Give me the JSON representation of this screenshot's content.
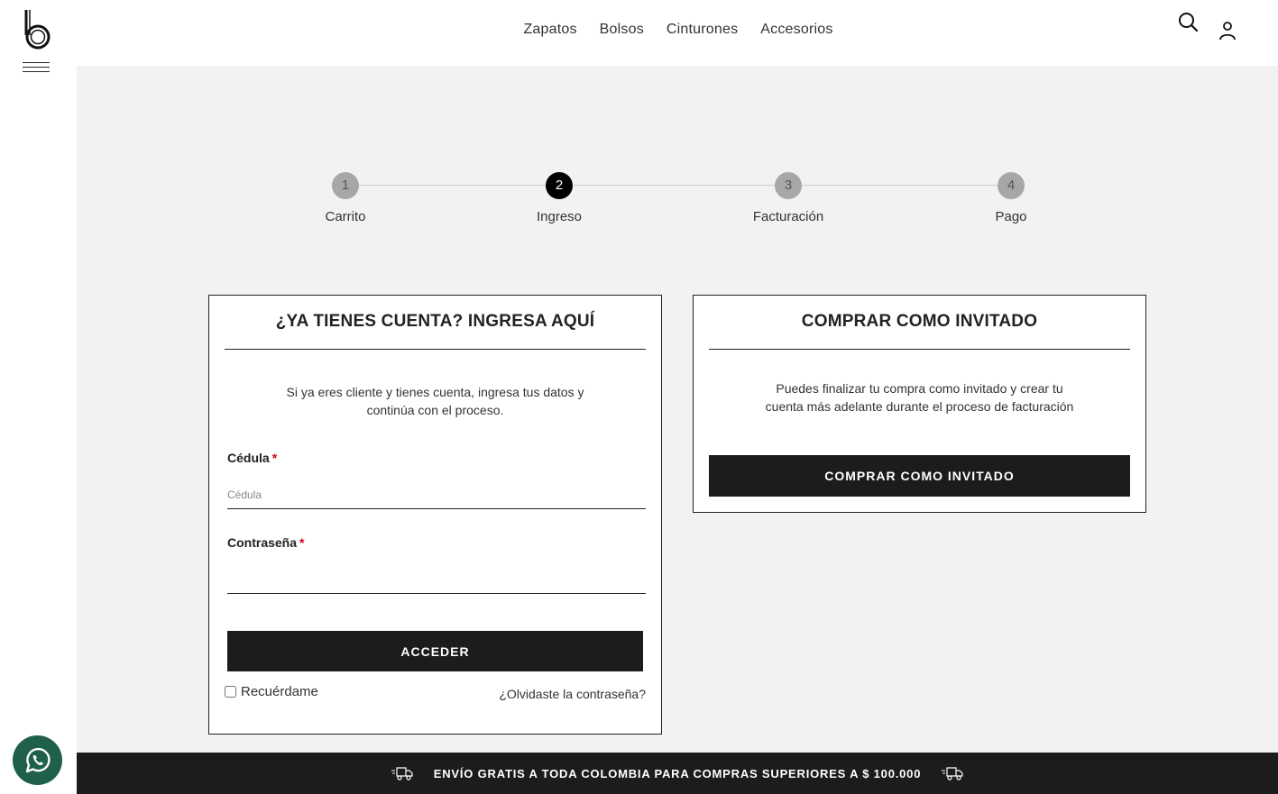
{
  "nav": {
    "items": [
      "Zapatos",
      "Bolsos",
      "Cinturones",
      "Accesorios"
    ]
  },
  "stepper": {
    "steps": [
      {
        "number": "1",
        "label": "Carrito"
      },
      {
        "number": "2",
        "label": "Ingreso"
      },
      {
        "number": "3",
        "label": "Facturación"
      },
      {
        "number": "4",
        "label": "Pago"
      }
    ],
    "active_step": 2
  },
  "login": {
    "title": "¿YA TIENES CUENTA? INGRESA AQUÍ",
    "description": "Si ya eres cliente y tienes cuenta, ingresa tus datos y continúa con el proceso.",
    "cedula_label": "Cédula",
    "cedula_required": "*",
    "cedula_placeholder": "Cédula",
    "cedula_value": "",
    "password_label": "Contraseña",
    "password_required": "*",
    "password_value": "",
    "submit_label": "ACCEDER",
    "remember_label": "Recuérdame",
    "forgot_label": "¿Olvidaste la contraseña?"
  },
  "guest": {
    "title": "COMPRAR COMO INVITADO",
    "description": "Puedes finalizar tu compra como invitado y crear tu cuenta más adelante durante el proceso de facturación",
    "button_label": "COMPRAR COMO INVITADO"
  },
  "banner": {
    "text": "ENVÍO GRATIS A TODA COLOMBIA PARA COMPRAS SUPERIORES A $ 100.000"
  },
  "icons": {
    "logo": "brand-logo-b",
    "menu": "hamburger-icon",
    "search": "search-icon",
    "user": "user-icon",
    "truck": "truck-icon",
    "whatsapp": "whatsapp-icon"
  },
  "colors": {
    "accent": "#1c1c1c",
    "background": "#f2f2f2",
    "required": "#d0021b",
    "step_inactive": "#a7a7a7",
    "whatsapp": "#1f5f4c"
  }
}
